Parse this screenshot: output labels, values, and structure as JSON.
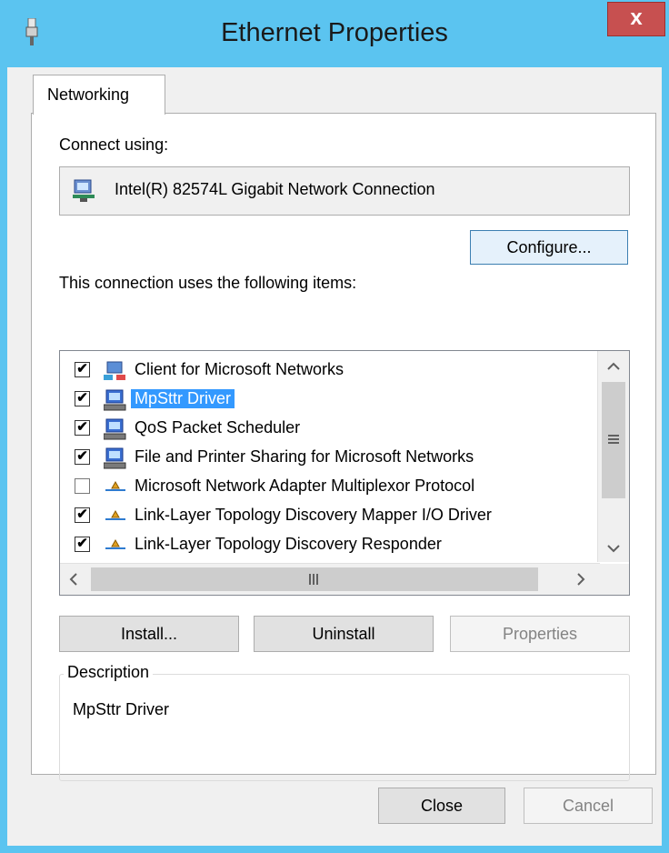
{
  "window": {
    "title": "Ethernet Properties",
    "close_glyph": "x"
  },
  "tabs": [
    {
      "label": "Networking"
    }
  ],
  "connect_using": {
    "label": "Connect using:",
    "adapter": "Intel(R) 82574L Gigabit Network Connection"
  },
  "configure_button": {
    "label": "Configure..."
  },
  "items_section": {
    "label": "This connection uses the following items:"
  },
  "items": [
    {
      "label": "Client for Microsoft Networks",
      "checked": true,
      "icon": "network-client-icon"
    },
    {
      "label": "MpSttr Driver",
      "checked": true,
      "icon": "network-service-icon",
      "selected": true
    },
    {
      "label": "QoS Packet Scheduler",
      "checked": true,
      "icon": "network-service-icon"
    },
    {
      "label": "File and Printer Sharing for Microsoft Networks",
      "checked": true,
      "icon": "network-service-icon"
    },
    {
      "label": "Microsoft Network Adapter Multiplexor Protocol",
      "checked": false,
      "icon": "network-protocol-icon"
    },
    {
      "label": "Link-Layer Topology Discovery Mapper I/O Driver",
      "checked": true,
      "icon": "network-protocol-icon"
    },
    {
      "label": "Link-Layer Topology Discovery Responder",
      "checked": true,
      "icon": "network-protocol-icon"
    }
  ],
  "buttons": {
    "install": "Install...",
    "uninstall": "Uninstall",
    "properties": "Properties"
  },
  "description": {
    "legend": "Description",
    "text": "MpSttr Driver"
  },
  "footer": {
    "close": "Close",
    "cancel": "Cancel"
  },
  "colors": {
    "titlebar": "#5bc4f0",
    "close_button": "#c75050",
    "selection": "#3399ff"
  }
}
